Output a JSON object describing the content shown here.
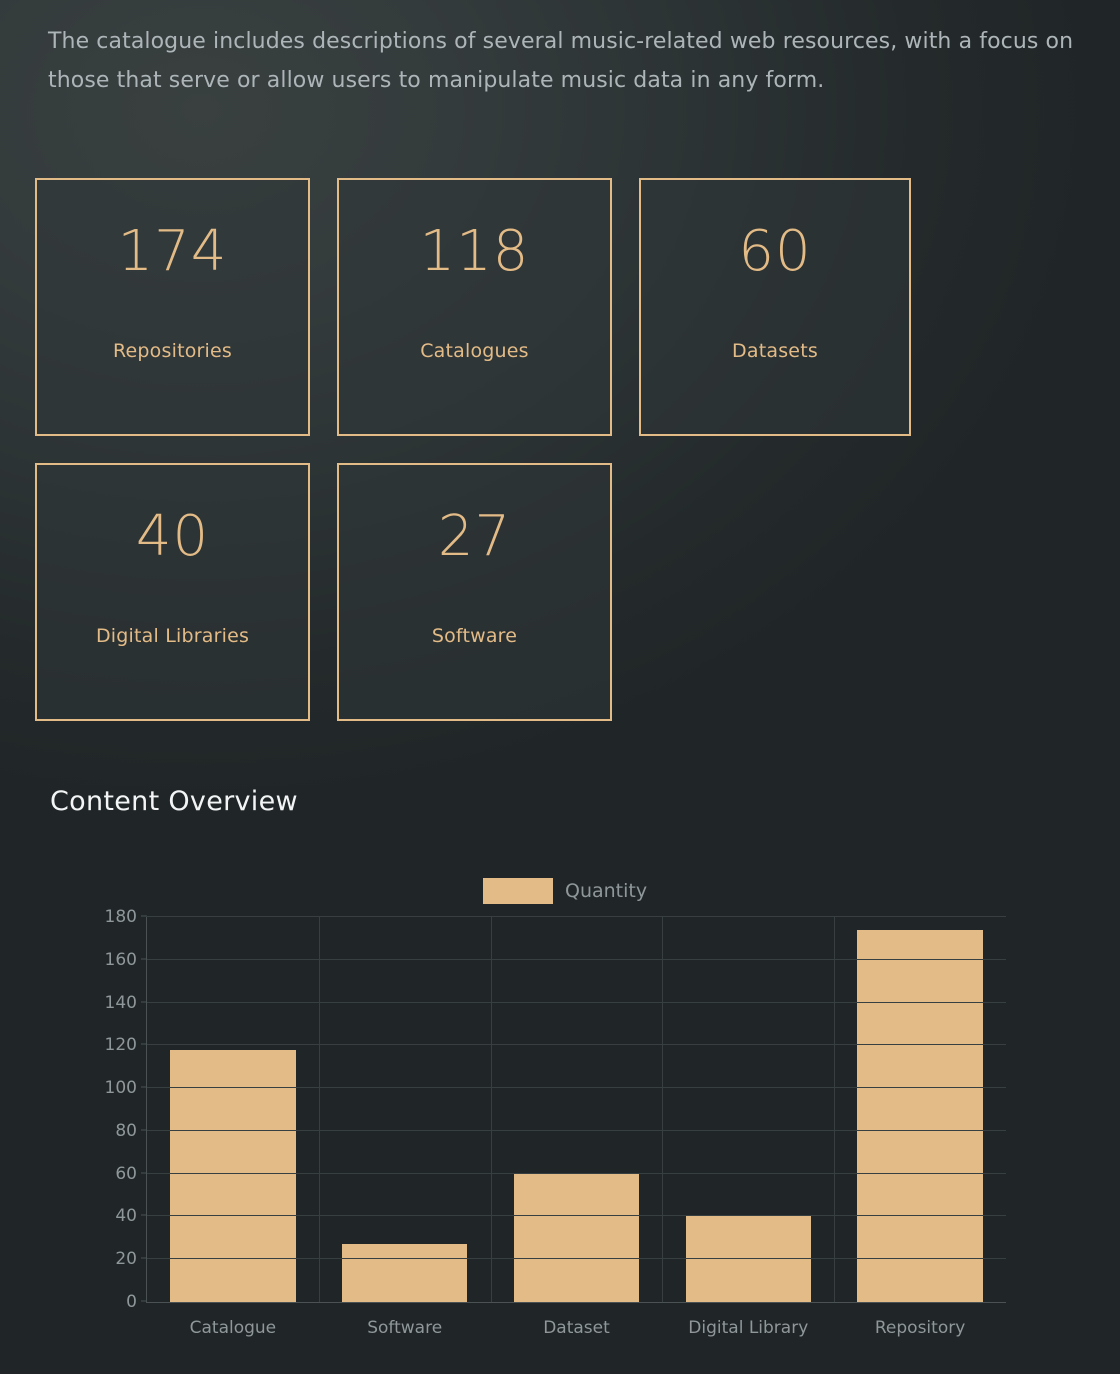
{
  "intro": {
    "text": "The catalogue includes descriptions of several music-related web resources, with a focus on those that serve or allow users to manipulate music data in any form."
  },
  "colors": {
    "accent": "#e3bb87",
    "background": "#2c3334",
    "card_fill": "#333b3b",
    "body_text": "#aeb5b9",
    "heading_text": "#f2f4f5",
    "axis_text": "#8f979b",
    "grid": "#373f40"
  },
  "stat_cards": [
    {
      "value": "174",
      "label": "Repositories"
    },
    {
      "value": "118",
      "label": "Catalogues"
    },
    {
      "value": "60",
      "label": "Datasets"
    },
    {
      "value": "40",
      "label": "Digital Libraries"
    },
    {
      "value": "27",
      "label": "Software"
    }
  ],
  "section": {
    "title": "Content Overview"
  },
  "chart_data": {
    "type": "bar",
    "title": "Content Overview",
    "xlabel": "",
    "ylabel": "",
    "categories": [
      "Catalogue",
      "Software",
      "Dataset",
      "Digital Library",
      "Repository"
    ],
    "series": [
      {
        "name": "Quantity",
        "values": [
          118,
          27,
          60,
          40,
          174
        ],
        "color": "#e3bb87"
      }
    ],
    "values": [
      118,
      27,
      60,
      40,
      174
    ],
    "ylim": [
      0,
      180
    ],
    "yticks": [
      0,
      20,
      40,
      60,
      80,
      100,
      120,
      140,
      160,
      180
    ],
    "ytick_labels": [
      "0",
      "20",
      "40",
      "60",
      "80",
      "100",
      "120",
      "140",
      "160",
      "180"
    ],
    "grid": true,
    "legend": {
      "position": "top-center",
      "entries": [
        "Quantity"
      ]
    }
  }
}
